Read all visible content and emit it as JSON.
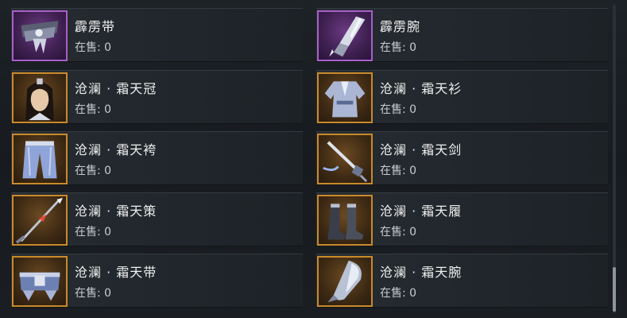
{
  "sale_prefix": "在售: ",
  "items": [
    {
      "name": "霹雳带",
      "count": "0",
      "rarity": "purple",
      "icon": "belt-icon"
    },
    {
      "name": "霹雳腕",
      "count": "0",
      "rarity": "purple",
      "icon": "gauntlet-icon"
    },
    {
      "name": "沧澜 · 霜天冠",
      "count": "0",
      "rarity": "gold",
      "icon": "crown-portrait-icon"
    },
    {
      "name": "沧澜 · 霜天衫",
      "count": "0",
      "rarity": "gold",
      "icon": "robe-icon"
    },
    {
      "name": "沧澜 · 霜天袴",
      "count": "0",
      "rarity": "gold",
      "icon": "trousers-icon"
    },
    {
      "name": "沧澜 · 霜天剑",
      "count": "0",
      "rarity": "gold",
      "icon": "sword-icon"
    },
    {
      "name": "沧澜 · 霜天策",
      "count": "0",
      "rarity": "gold",
      "icon": "spear-icon"
    },
    {
      "name": "沧澜 · 霜天履",
      "count": "0",
      "rarity": "gold",
      "icon": "boots-icon"
    },
    {
      "name": "沧澜 · 霜天带",
      "count": "0",
      "rarity": "gold",
      "icon": "belt-icon"
    },
    {
      "name": "沧澜 · 霜天腕",
      "count": "0",
      "rarity": "gold",
      "icon": "gauntlet-icon"
    }
  ],
  "colors": {
    "gold_frame": "#c98a2a",
    "purple_frame": "#a860c8"
  }
}
